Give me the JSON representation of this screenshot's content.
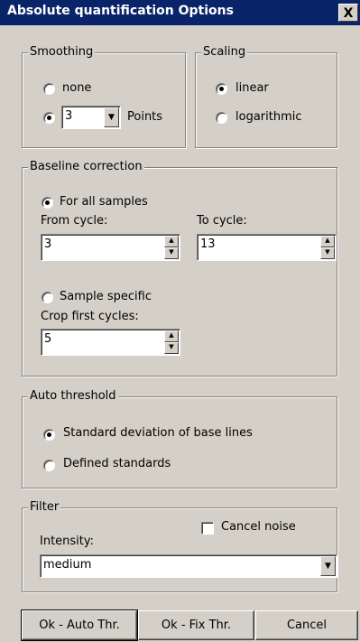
{
  "window": {
    "title": "Absolute quantification Options",
    "close_label": "X"
  },
  "smoothing": {
    "legend": "Smoothing",
    "none_label": "none",
    "points_value": "3",
    "points_label": "Points",
    "selected": "points"
  },
  "scaling": {
    "legend": "Scaling",
    "linear_label": "linear",
    "log_label": "logarithmic",
    "selected": "linear"
  },
  "baseline": {
    "legend": "Baseline correction",
    "all_samples_label": "For all samples",
    "from_label": "From cycle:",
    "from_value": "3",
    "to_label": "To cycle:",
    "to_value": "13",
    "sample_specific_label": "Sample specific",
    "crop_label": "Crop first cycles:",
    "crop_value": "5",
    "selected": "all_samples"
  },
  "auto_threshold": {
    "legend": "Auto threshold",
    "stddev_label": "Standard deviation of base lines",
    "defined_label": "Defined standards",
    "selected": "stddev"
  },
  "filter": {
    "legend": "Filter",
    "cancel_noise_label": "Cancel noise",
    "cancel_noise_checked": false,
    "intensity_label": "Intensity:",
    "intensity_value": "medium"
  },
  "buttons": {
    "ok_auto": "Ok - Auto Thr.",
    "ok_fix": "Ok - Fix Thr.",
    "cancel": "Cancel"
  }
}
